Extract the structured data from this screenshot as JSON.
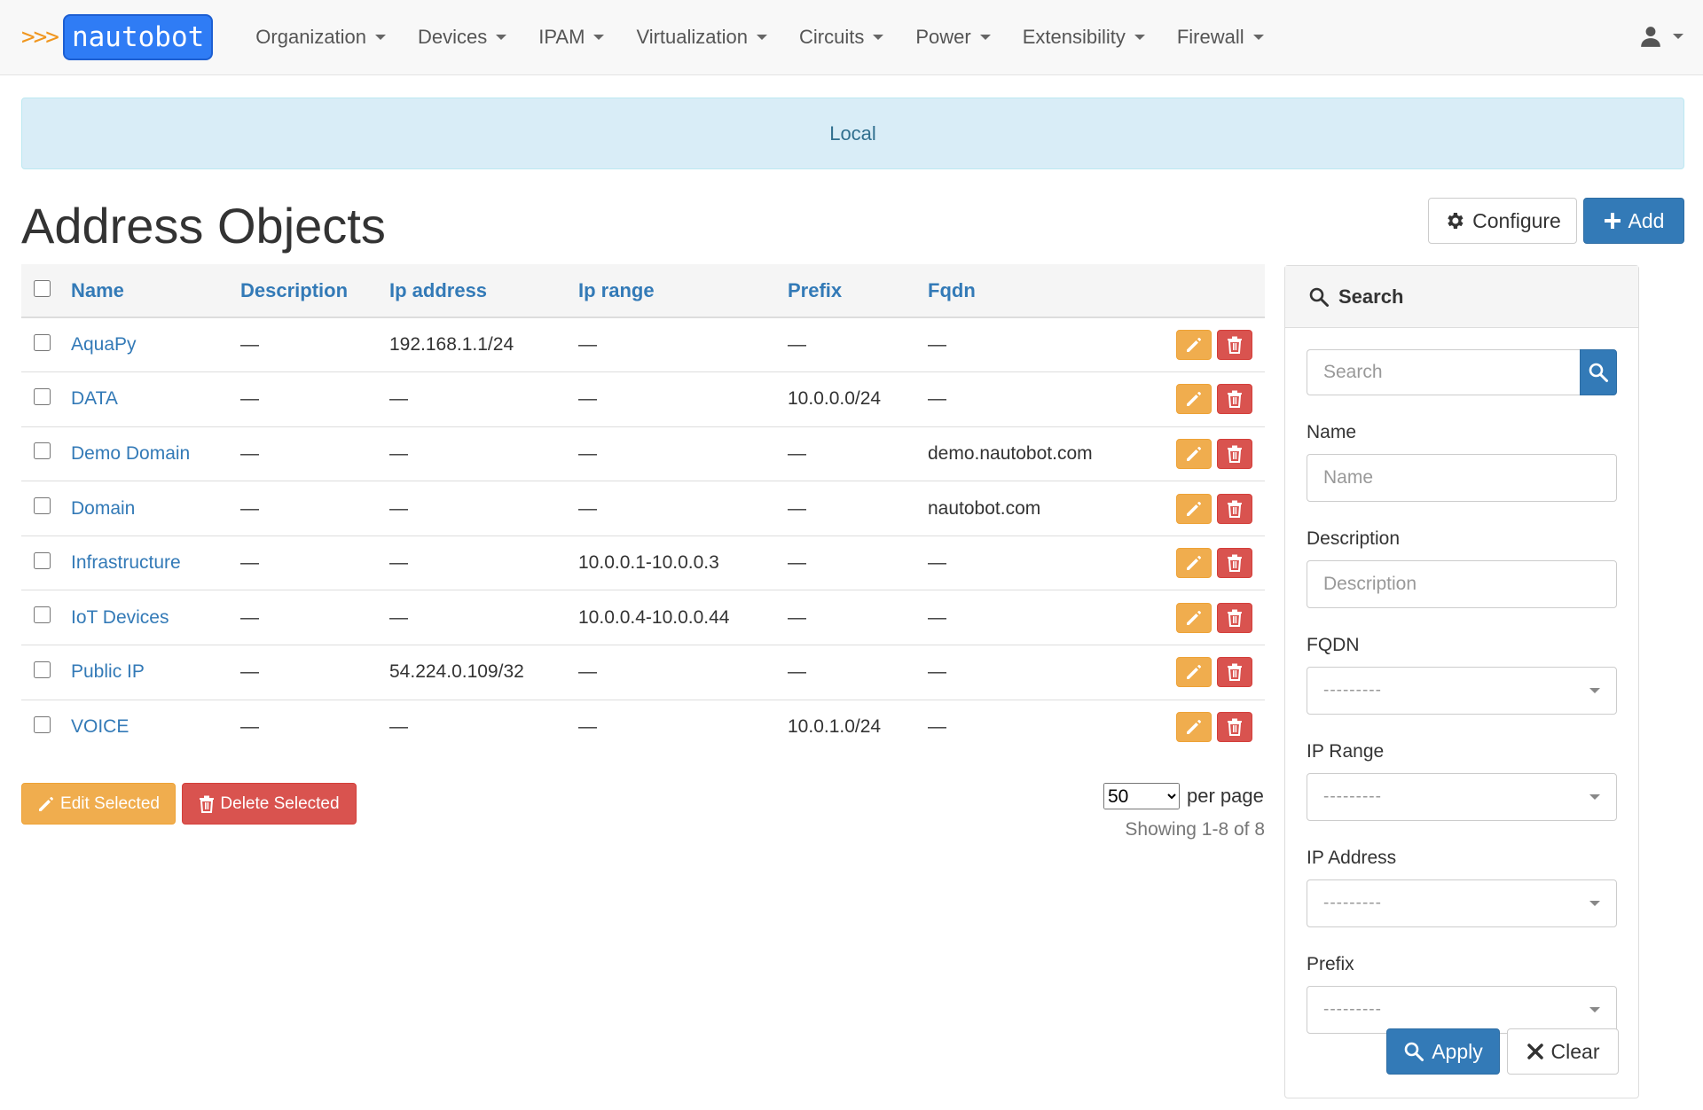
{
  "brand": {
    "arrows": ">>>",
    "name": "nautobot"
  },
  "nav": {
    "items": [
      "Organization",
      "Devices",
      "IPAM",
      "Virtualization",
      "Circuits",
      "Power",
      "Extensibility",
      "Firewall"
    ]
  },
  "alert": {
    "text": "Local"
  },
  "page": {
    "title": "Address Objects"
  },
  "toolbar": {
    "configure_label": "Configure",
    "add_label": "Add"
  },
  "table": {
    "columns": [
      "Name",
      "Description",
      "Ip address",
      "Ip range",
      "Prefix",
      "Fqdn"
    ],
    "rows": [
      [
        "AquaPy",
        "—",
        "192.168.1.1/24",
        "—",
        "—",
        "—"
      ],
      [
        "DATA",
        "—",
        "—",
        "—",
        "10.0.0.0/24",
        "—"
      ],
      [
        "Demo Domain",
        "—",
        "—",
        "—",
        "—",
        "demo.nautobot.com"
      ],
      [
        "Domain",
        "—",
        "—",
        "—",
        "—",
        "nautobot.com"
      ],
      [
        "Infrastructure",
        "—",
        "—",
        "10.0.0.1-10.0.0.3",
        "—",
        "—"
      ],
      [
        "IoT Devices",
        "—",
        "—",
        "10.0.0.4-10.0.0.44",
        "—",
        "—"
      ],
      [
        "Public IP",
        "—",
        "54.224.0.109/32",
        "—",
        "—",
        "—"
      ],
      [
        "VOICE",
        "—",
        "—",
        "—",
        "10.0.1.0/24",
        "—"
      ]
    ]
  },
  "bulk": {
    "edit_label": "Edit Selected",
    "delete_label": "Delete Selected"
  },
  "pagination": {
    "per_page_value": "50",
    "per_page_label": "per page",
    "showing": "Showing 1-8 of 8"
  },
  "search_panel": {
    "heading": "Search",
    "search_placeholder": "Search",
    "fields": {
      "name": {
        "label": "Name",
        "placeholder": "Name"
      },
      "description": {
        "label": "Description",
        "placeholder": "Description"
      },
      "fqdn": {
        "label": "FQDN",
        "value": "---------"
      },
      "ip_range": {
        "label": "IP Range",
        "value": "---------"
      },
      "ip_address": {
        "label": "IP Address",
        "value": "---------"
      },
      "prefix": {
        "label": "Prefix",
        "value": "---------"
      }
    },
    "apply_label": "Apply",
    "clear_label": "Clear"
  },
  "colors": {
    "primary": "#337ab7",
    "warning": "#f0ad4e",
    "danger": "#d9534f",
    "info_bg": "#d9edf7"
  }
}
